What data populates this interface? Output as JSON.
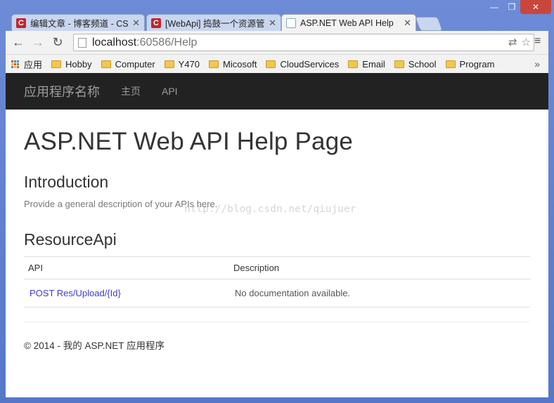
{
  "window": {
    "minimize_glyph": "—",
    "maximize_glyph": "❐",
    "close_glyph": "✕"
  },
  "tabs": [
    {
      "title": "编辑文章 - 博客频道 - CS",
      "icon": "csdn-icon",
      "close": "✕"
    },
    {
      "title": "[WebApi] 捣鼓一个资源管",
      "icon": "csdn-icon",
      "close": "✕"
    },
    {
      "title": "ASP.NET Web API Help",
      "icon": "page-icon",
      "close": "✕"
    }
  ],
  "toolbar": {
    "back_glyph": "←",
    "forward_glyph": "→",
    "reload_glyph": "↻",
    "url_host": "localhost",
    "url_rest": ":60586/Help",
    "translate_glyph": "⇄",
    "star_glyph": "☆",
    "menu_glyph": "≡"
  },
  "bookmarks": {
    "apps_label": "应用",
    "items": [
      "Hobby",
      "Computer",
      "Y470",
      "Micosoft",
      "CloudServices",
      "Email",
      "School",
      "Program"
    ],
    "more": "»"
  },
  "page": {
    "brand": "应用程序名称",
    "nav": [
      "主页",
      "API"
    ],
    "title": "ASP.NET Web API Help Page",
    "intro_heading": "Introduction",
    "intro_text": "Provide a general description of your APIs here.",
    "resource_heading": "ResourceApi",
    "table": {
      "headers": [
        "API",
        "Description"
      ],
      "rows": [
        {
          "api": "POST Res/Upload/{Id}",
          "description": "No documentation available."
        }
      ]
    },
    "footer": "© 2014 - 我的 ASP.NET 应用程序",
    "watermark": "http://blog.csdn.net/qiujuer"
  }
}
